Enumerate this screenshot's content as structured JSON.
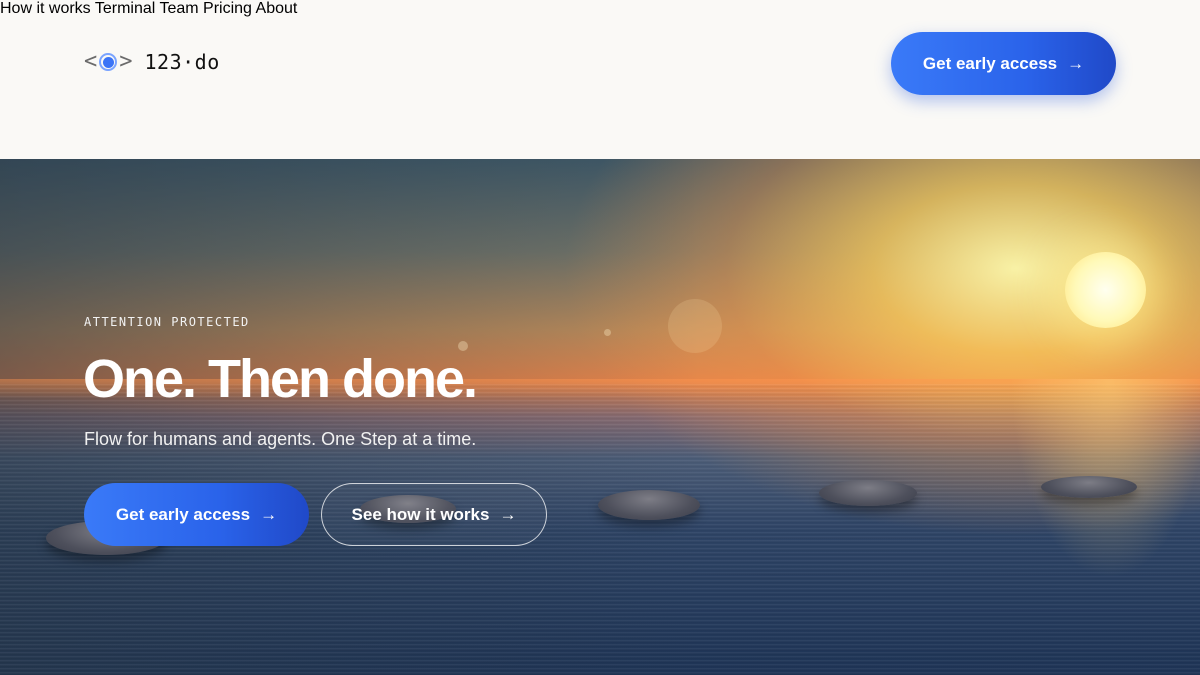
{
  "brand": {
    "name": "123·do",
    "accent": "#2a63ea"
  },
  "nav": {
    "items": [
      {
        "label": "How it works"
      },
      {
        "label": "Terminal"
      },
      {
        "label": "Team"
      },
      {
        "label": "Pricing"
      },
      {
        "label": "About"
      }
    ],
    "cta_label": "Get early access"
  },
  "hero": {
    "kicker": "ATTENTION PROTECTED",
    "headline": "One. Then done.",
    "subheadline": "Flow for humans and agents. One Step at a time.",
    "primary_cta": "Get early access",
    "secondary_cta": "See how it works",
    "arrow": "→"
  }
}
